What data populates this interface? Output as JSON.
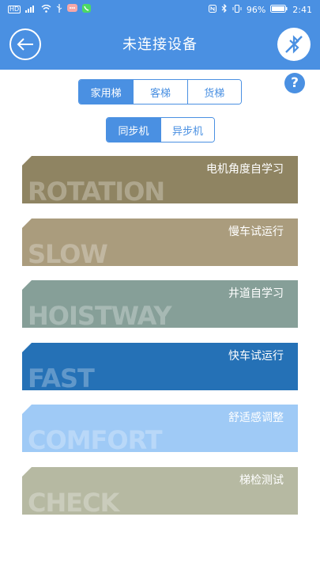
{
  "status_bar": {
    "left_icons": [
      "HD",
      "4G",
      "wifi",
      "usb",
      "msg",
      "call"
    ],
    "battery": "96%",
    "time": "2:41"
  },
  "header": {
    "title": "未连接设备",
    "back_icon": "back-arrow-icon",
    "bt_icon": "bluetooth-disabled-icon",
    "color": "#4a90e2"
  },
  "help": {
    "label": "?"
  },
  "elevator_type": {
    "options": [
      "家用梯",
      "客梯",
      "货梯"
    ],
    "selected": "家用梯"
  },
  "motor_type": {
    "options": [
      "同步机",
      "异步机"
    ],
    "selected": "同步机"
  },
  "cards": [
    {
      "label": "电机角度自学习",
      "en": "ROTATION",
      "color": "#8f8462"
    },
    {
      "label": "慢车试运行",
      "en": "SLOW",
      "color": "#aa9c7d"
    },
    {
      "label": "井道自学习",
      "en": "HOISTWAY",
      "color": "#869f98"
    },
    {
      "label": "快车试运行",
      "en": "FAST",
      "color": "#2571b6"
    },
    {
      "label": "舒适感调整",
      "en": "COMFORT",
      "color": "#9fcaf6"
    },
    {
      "label": "梯检测试",
      "en": "CHECK",
      "color": "#b6b9a2"
    }
  ]
}
